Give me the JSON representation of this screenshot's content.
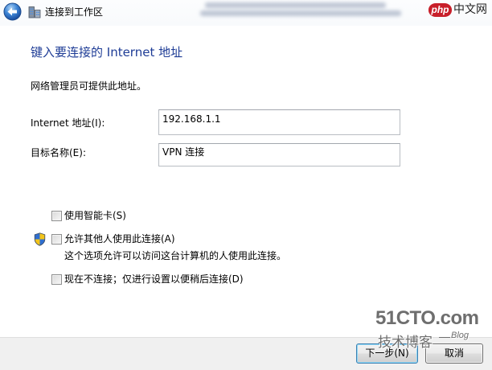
{
  "window": {
    "title": "连接到工作区",
    "back_icon": "back-arrow-icon",
    "app_icon": "workplace-network-icon"
  },
  "page": {
    "heading": "键入要连接的 Internet 地址",
    "description": "网络管理员可提供此地址。"
  },
  "form": {
    "address": {
      "label": "Internet 地址(I):",
      "value": "192.168.1.1"
    },
    "destination": {
      "label": "目标名称(E):",
      "value": "VPN 连接"
    }
  },
  "options": {
    "smart_card": {
      "label": "使用智能卡(S)",
      "checked": false
    },
    "allow_others": {
      "label": "允许其他人使用此连接(A)",
      "checked": false,
      "icon": "uac-shield-icon",
      "hint": "这个选项允许可以访问这台计算机的人使用此连接。"
    },
    "connect_later": {
      "label": "现在不连接；仅进行设置以便稍后连接(D)",
      "checked": false
    }
  },
  "footer": {
    "next_label": "下一步(N)",
    "cancel_label": "取消"
  },
  "watermarks": {
    "php_badge": "php",
    "php_name": "中文网",
    "cto_domain": "51CTO.com",
    "cto_blog_cn": "技术博客",
    "cto_blog_en": "Blog"
  },
  "colors": {
    "heading": "#1E3C96",
    "footer_bg": "#F0F0F0",
    "default_button_border": "#3C7FB1",
    "button_border": "#707070",
    "php_brand": "#C81F2A",
    "watermark": "#6E6E6E"
  }
}
